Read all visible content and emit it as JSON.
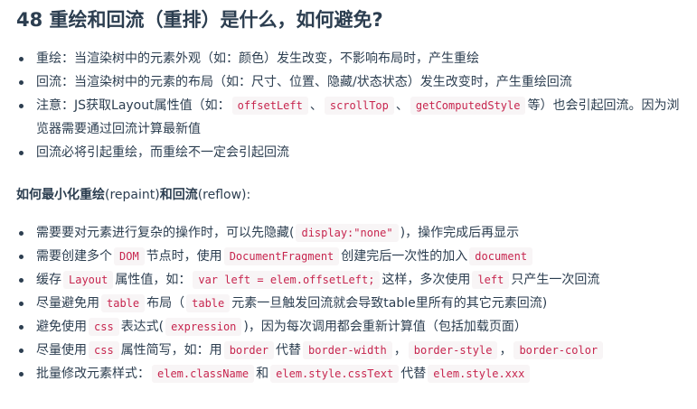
{
  "title": "48 重绘和回流（重排）是什么，如何避免?",
  "list1": [
    {
      "t": "重绘：当渲染树中的元素外观（如：颜色）发生改变，不影响布局时，产生重绘"
    },
    {
      "t": "回流：当渲染树中的元素的布局（如：尺寸、位置、隐藏/状态状态）发生改变时，产生重绘回流"
    },
    {
      "t1": "注意：JS获取Layout属性值（如：",
      "c1": "offsetLeft",
      "t2": "、",
      "c2": "scrollTop",
      "t3": "、",
      "c3": "getComputedStyle",
      "t4": "等）也会引起回流。因为浏览器需要通过回流计算最新值"
    },
    {
      "t": "回流必将引起重绘，而重绘不一定会引起回流"
    }
  ],
  "subhead": {
    "part1": "如何最小化重绘",
    "part2": "(repaint)",
    "part3": "和回流",
    "part4": "(reflow)",
    "part5": ":"
  },
  "list2": [
    {
      "t1": "需要要对元素进行复杂的操作时，可以先隐藏(",
      "c1": "display:\"none\"",
      "t2": ")，操作完成后再显示"
    },
    {
      "t1": "需要创建多个",
      "c1": "DOM",
      "t2": "节点时，使用",
      "c2": "DocumentFragment",
      "t3": "创建完后一次性的加入",
      "c3": "document"
    },
    {
      "t1": "缓存",
      "c1": "Layout",
      "t2": "属性值，如：",
      "c2": "var left = elem.offsetLeft;",
      "t3": "这样，多次使用",
      "c3": "left",
      "t4": "只产生一次回流"
    },
    {
      "t1": "尽量避免用",
      "c1": "table",
      "t2": "布局（",
      "c2": "table",
      "t3": "元素一旦触发回流就会导致table里所有的其它元素回流)"
    },
    {
      "t1": "避免使用",
      "c1": "css",
      "t2": "表达式(",
      "c2": "expression",
      "t3": ")，因为每次调用都会重新计算值（包括加载页面）"
    },
    {
      "t1": "尽量使用",
      "c1": "css",
      "t2": "属性简写，如：用",
      "c2": "border",
      "t3": "代替",
      "c3": "border-width",
      "t4": "，",
      "c4": "border-style",
      "t5": "，",
      "c5": "border-color"
    },
    {
      "t1": "批量修改元素样式：",
      "c1": "elem.className",
      "t2": "和",
      "c2": "elem.style.cssText",
      "t3": "代替",
      "c3": "elem.style.xxx"
    }
  ]
}
